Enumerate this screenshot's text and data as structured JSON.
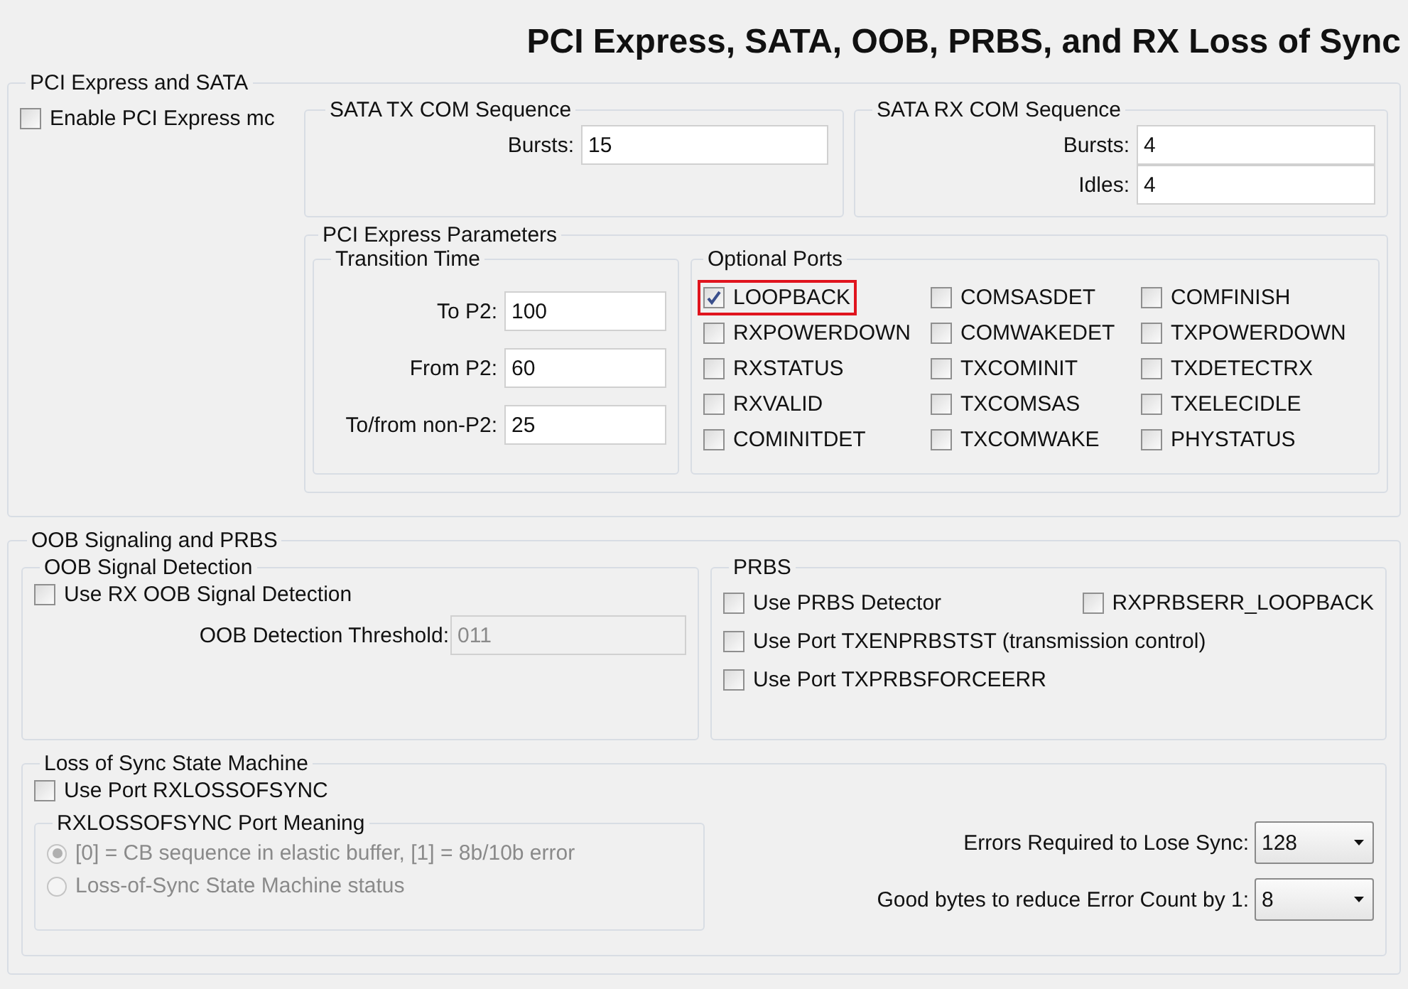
{
  "title": "PCI Express, SATA, OOB, PRBS, and RX Loss of Sync",
  "pci_sata": {
    "legend": "PCI Express and SATA",
    "enable": {
      "label": "Enable PCI Express mc",
      "checked": false
    },
    "sata_tx": {
      "legend": "SATA TX COM Sequence",
      "fields": [
        {
          "label": "Bursts:",
          "value": "15"
        }
      ]
    },
    "sata_rx": {
      "legend": "SATA RX COM Sequence",
      "fields": [
        {
          "label": "Bursts:",
          "value": "4"
        },
        {
          "label": "Idles:",
          "value": "4"
        }
      ]
    },
    "pci_params": {
      "legend": "PCI Express Parameters",
      "transition_time": {
        "legend": "Transition Time",
        "fields": [
          {
            "label": "To P2:",
            "value": "100"
          },
          {
            "label": "From P2:",
            "value": "60"
          },
          {
            "label": "To/from non-P2:",
            "value": "25"
          }
        ]
      },
      "optional_ports": {
        "legend": "Optional Ports",
        "ports": [
          {
            "label": "LOOPBACK",
            "checked": true,
            "highlighted": true
          },
          {
            "label": "COMSASDET",
            "checked": false,
            "highlighted": false
          },
          {
            "label": "COMFINISH",
            "checked": false,
            "highlighted": false
          },
          {
            "label": "RXPOWERDOWN",
            "checked": false,
            "highlighted": false
          },
          {
            "label": "COMWAKEDET",
            "checked": false,
            "highlighted": false
          },
          {
            "label": "TXPOWERDOWN",
            "checked": false,
            "highlighted": false
          },
          {
            "label": "RXSTATUS",
            "checked": false,
            "highlighted": false
          },
          {
            "label": "TXCOMINIT",
            "checked": false,
            "highlighted": false
          },
          {
            "label": "TXDETECTRX",
            "checked": false,
            "highlighted": false
          },
          {
            "label": "RXVALID",
            "checked": false,
            "highlighted": false
          },
          {
            "label": "TXCOMSAS",
            "checked": false,
            "highlighted": false
          },
          {
            "label": "TXELECIDLE",
            "checked": false,
            "highlighted": false
          },
          {
            "label": "COMINITDET",
            "checked": false,
            "highlighted": false
          },
          {
            "label": "TXCOMWAKE",
            "checked": false,
            "highlighted": false
          },
          {
            "label": "PHYSTATUS",
            "checked": false,
            "highlighted": false
          }
        ]
      }
    }
  },
  "oob_prbs": {
    "legend": "OOB Signaling and PRBS",
    "oob_detection": {
      "legend": "OOB Signal Detection",
      "use": {
        "label": "Use RX OOB Signal Detection",
        "checked": false
      },
      "threshold": {
        "label": "OOB Detection Threshold:",
        "value": "011",
        "disabled": true
      }
    },
    "prbs": {
      "legend": "PRBS",
      "options": [
        {
          "label": "Use PRBS Detector",
          "checked": false
        },
        {
          "label": "RXPRBSERR_LOOPBACK",
          "checked": false
        },
        {
          "label": "Use Port TXENPRBSTST (transmission control)",
          "checked": false
        },
        {
          "label": "Use Port TXPRBSFORCEERR",
          "checked": false
        }
      ]
    },
    "loss_of_sync": {
      "legend": "Loss of Sync State Machine",
      "use": {
        "label": "Use Port RXLOSSOFSYNC",
        "checked": false
      },
      "meaning": {
        "legend": "RXLOSSOFSYNC Port Meaning",
        "disabled": true,
        "options": [
          {
            "label": "[0] = CB sequence in elastic buffer, [1] =  8b/10b error",
            "selected": true
          },
          {
            "label": "Loss-of-Sync State Machine status",
            "selected": false
          }
        ]
      },
      "selects": [
        {
          "label": "Errors Required to Lose Sync:",
          "value": "128"
        },
        {
          "label": "Good bytes to reduce Error Count by 1:",
          "value": "8"
        }
      ]
    }
  }
}
